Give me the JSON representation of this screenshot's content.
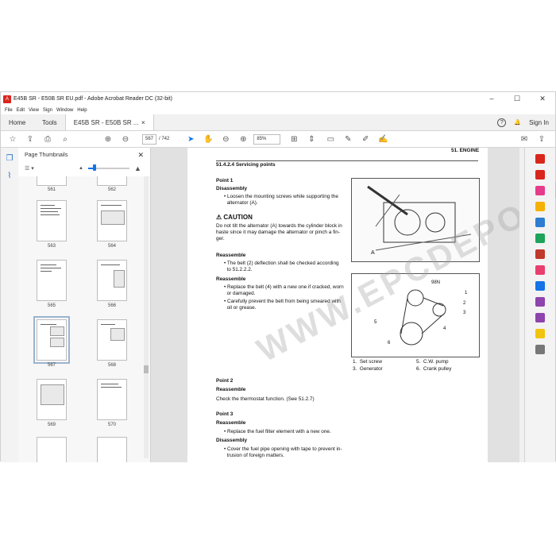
{
  "window": {
    "title": "E45B SR - E50B SR EU.pdf - Adobe Acrobat Reader DC (32-bit)",
    "controls": [
      "–",
      "☐",
      "✕"
    ]
  },
  "menu": [
    "File",
    "Edit",
    "View",
    "Sign",
    "Window",
    "Help"
  ],
  "tabs": {
    "home": "Home",
    "tools": "Tools",
    "doc": "E45B SR - E50B SR ...",
    "doc_close": "×",
    "sign_in": "Sign In",
    "help": "?",
    "bell": "🔔"
  },
  "toolbar": {
    "page_current": "567",
    "page_total": "/ 742",
    "zoom": "85%"
  },
  "thumbs_panel": {
    "title": "Page Thumbnails",
    "close": "✕",
    "pages": [
      "561",
      "562",
      "563",
      "564",
      "565",
      "566",
      "567",
      "568",
      "569",
      "570"
    ]
  },
  "document": {
    "header_right": "51. ENGINE",
    "section": "51.4.2.4   Servicing points",
    "point1": "Point 1",
    "disassembly1": "Disassembly",
    "bullet1a": "Loosen the mounting screws while supporting the",
    "bullet1b": "alternator (A).",
    "caution_title": "CAUTION",
    "caution1": "Do not tilt the alternator (A) towards the cylinder block in",
    "caution2": "haste since it may damage the alternator or pinch a fin-",
    "caution3": "ger.",
    "reassembly1": "Reassemble",
    "bullet2a": "The belt (2) deflection shall be checked according",
    "bullet2b": "to 51.2.2.2.",
    "reassembly2": "Reassemble",
    "bullet3a": "Replace the belt (4) with a new one if cracked, worn",
    "bullet3b": "or damaged.",
    "bullet4a": "Carefully prevent the belt from being smeared with",
    "bullet4b": "oil or grease.",
    "fig_label_a": "A",
    "fig2_label": "98N",
    "legend": [
      {
        "n": "1.",
        "t": "Set screw"
      },
      {
        "n": "3.",
        "t": "Generator"
      },
      {
        "n": "5.",
        "t": "C.W. pump"
      },
      {
        "n": "6.",
        "t": "Crank pulley"
      }
    ],
    "point2": "Point 2",
    "reassemble3": "Reassemble",
    "thermostat": "Check the thermostat function. (See 51.2.7)",
    "point3": "Point 3",
    "reassemble4": "Reassemble",
    "bullet5": "Replace the fuel filter element with a new one.",
    "disassembly2": "Disassembly",
    "bullet6a": "Cover the fuel pipe opening with tape to prevent in-",
    "bullet6b": "trusion of foreign matters.",
    "watermark": "WWW.EPCDEPOT.COM"
  }
}
